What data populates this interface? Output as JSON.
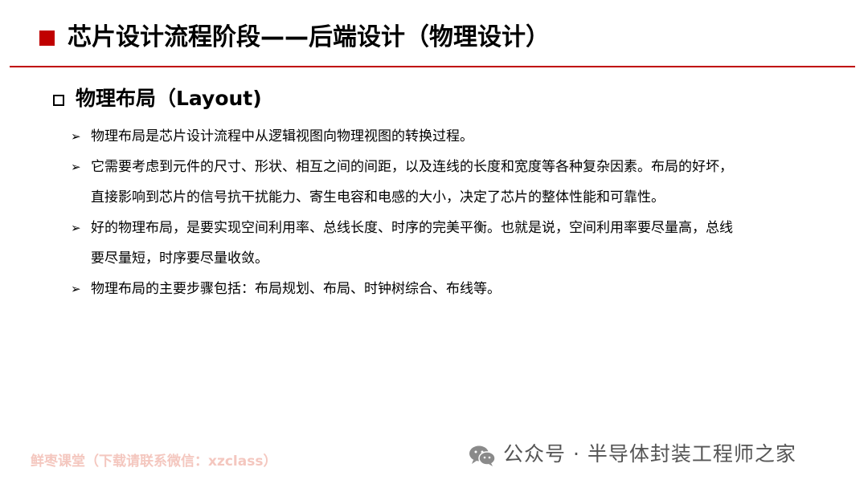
{
  "header": {
    "title": "芯片设计流程阶段——后端设计（物理设计）",
    "accent_color": "#c00000"
  },
  "section": {
    "heading": "物理布局（Layout)",
    "marker_icon": "hollow-square-icon"
  },
  "bullets": [
    {
      "marker": "➢",
      "lines": [
        "物理布局是芯片设计流程中从逻辑视图向物理视图的转换过程。"
      ]
    },
    {
      "marker": "➢",
      "lines": [
        "它需要考虑到元件的尺寸、形状、相互之间的间距，以及连线的长度和宽度等各种复杂因素。布局的好坏，",
        "直接影响到芯片的信号抗干扰能力、寄生电容和电感的大小，决定了芯片的整体性能和可靠性。"
      ]
    },
    {
      "marker": "➢",
      "lines": [
        "好的物理布局，是要实现空间利用率、总线长度、时序的完美平衡。也就是说，空间利用率要尽量高，总线",
        "要尽量短，时序要尽量收敛。"
      ]
    },
    {
      "marker": "➢",
      "lines": [
        "物理布局的主要步骤包括：布局规划、布局、时钟树综合、布线等。"
      ]
    }
  ],
  "footer": {
    "watermark_left": "鲜枣课堂（下载请联系微信：xzclass）",
    "watermark_right": "公众号 · 半导体封装工程师之家",
    "wechat_icon": "wechat-icon"
  }
}
